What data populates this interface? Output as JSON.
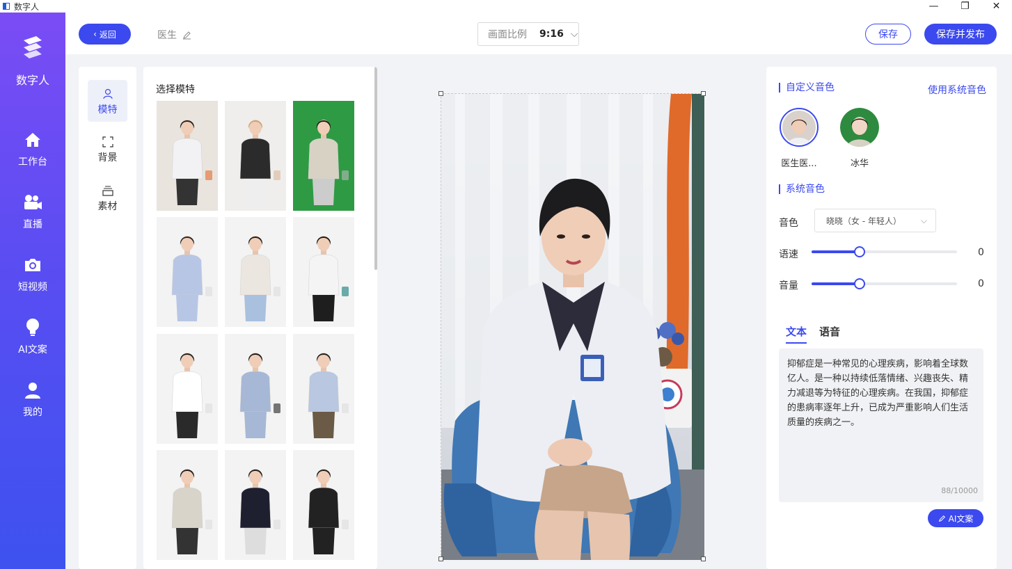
{
  "window": {
    "title": "数字人",
    "controls": [
      "—",
      "❐",
      "✕"
    ]
  },
  "sidebar": {
    "app_name": "数字人",
    "items": [
      {
        "label": "工作台",
        "icon": "home-icon"
      },
      {
        "label": "直播",
        "icon": "video-camera-icon"
      },
      {
        "label": "短视频",
        "icon": "camera-icon"
      },
      {
        "label": "AI文案",
        "icon": "lightbulb-icon"
      },
      {
        "label": "我的",
        "icon": "user-icon"
      }
    ]
  },
  "header": {
    "back_label": "返回",
    "doc_name": "医生",
    "ratio_label": "画面比例",
    "ratio_value": "9:16",
    "save_label": "保存",
    "publish_label": "保存并发布"
  },
  "tabs": [
    {
      "label": "模特",
      "icon": "person-icon",
      "active": true
    },
    {
      "label": "背景",
      "icon": "frame-icon",
      "active": false
    },
    {
      "label": "素材",
      "icon": "layers-icon",
      "active": false
    }
  ],
  "models": {
    "title": "选择模特",
    "thumbs": [
      {
        "bg": "#e9e4de",
        "coat": "#f2f2f4",
        "hair": "#222",
        "pants": "#333",
        "accent": "#e36b2b"
      },
      {
        "bg": "#efeeec",
        "coat": "#2b2b2b",
        "hair": "#c9a47a",
        "pants": "#eee",
        "accent": "#d8b89c"
      },
      {
        "bg": "#2f9a44",
        "coat": "#d8d2c4",
        "hair": "#1c1c1c",
        "pants": "#ccc",
        "accent": "#bbb"
      },
      {
        "bg": "#f3f3f3",
        "coat": "#b8c6e6",
        "hair": "#2a2a2a",
        "pants": "#b8c6e6",
        "accent": "#ddd"
      },
      {
        "bg": "#f3f3f3",
        "coat": "#ece6e0",
        "hair": "#222",
        "pants": "#a9c0de",
        "accent": "#ddd"
      },
      {
        "bg": "#f3f3f3",
        "coat": "#f4f4f4",
        "hair": "#1e1e1e",
        "pants": "#1e1e1e",
        "accent": "#0f7a7a"
      },
      {
        "bg": "#f3f3f3",
        "coat": "#ffffff",
        "hair": "#222",
        "pants": "#2a2a2a",
        "accent": "#ddd"
      },
      {
        "bg": "#f3f3f3",
        "coat": "#a7b7d6",
        "hair": "#1e1e1e",
        "pants": "#a7b7d6",
        "accent": "#222"
      },
      {
        "bg": "#f3f3f3",
        "coat": "#b9c7e0",
        "hair": "#222",
        "pants": "#6b5a45",
        "accent": "#ddd"
      },
      {
        "bg": "#f3f3f3",
        "coat": "#d9d4c9",
        "hair": "#1e1e1e",
        "pants": "#333",
        "accent": "#ddd"
      },
      {
        "bg": "#f3f3f3",
        "coat": "#1e2030",
        "hair": "#1e1e1e",
        "pants": "#ddd",
        "accent": "#ddd"
      },
      {
        "bg": "#f3f3f3",
        "coat": "#222222",
        "hair": "#1e1e1e",
        "pants": "#222",
        "accent": "#ddd"
      }
    ]
  },
  "right": {
    "custom_voice_title": "自定义音色",
    "use_system_voice": "使用系统音色",
    "voices": [
      {
        "label": "医生医...",
        "bg": "#d9d2cc",
        "selected": true
      },
      {
        "label": "冰华",
        "bg": "#2e8a3f",
        "selected": false
      }
    ],
    "system_voice_title": "系统音色",
    "voice_label": "音色",
    "voice_value": "晓晓（女 - 年轻人）",
    "speed_label": "语速",
    "speed_value": "0",
    "speed_level": 0.33,
    "volume_label": "音量",
    "volume_value": "0",
    "volume_level": 0.33,
    "tab_text": "文本",
    "tab_voice": "语音",
    "script_text": "抑郁症是一种常见的心理疾病，影响着全球数亿人。是一种以持续低落情绪、兴趣丧失、精力减退等为特征的心理疾病。在我国，抑郁症的患病率逐年上升，已成为严重影响人们生活质量的疾病之一。",
    "char_count": "88/10000",
    "ai_button": "AI文案"
  },
  "colors": {
    "accent": "#3b49ef",
    "sidebar_top": "#7b4cf5",
    "sidebar_bottom": "#3d52f0"
  }
}
